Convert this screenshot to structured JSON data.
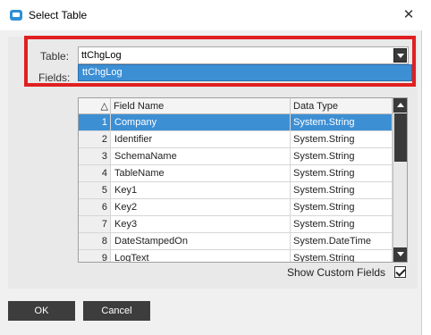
{
  "window": {
    "title": "Select Table"
  },
  "form": {
    "table_label": "Table:",
    "table_value": "ttChgLog",
    "fields_label": "Fields:",
    "dropdown_options": [
      "ttChgLog"
    ]
  },
  "grid": {
    "sort_icon": "triangle-up-icon",
    "columns": [
      "Field Name",
      "Data Type"
    ],
    "rows": [
      {
        "num": "1",
        "name": "Company",
        "type": "System.String",
        "selected": true
      },
      {
        "num": "2",
        "name": "Identifier",
        "type": "System.String"
      },
      {
        "num": "3",
        "name": "SchemaName",
        "type": "System.String"
      },
      {
        "num": "4",
        "name": "TableName",
        "type": "System.String"
      },
      {
        "num": "5",
        "name": "Key1",
        "type": "System.String"
      },
      {
        "num": "6",
        "name": "Key2",
        "type": "System.String"
      },
      {
        "num": "7",
        "name": "Key3",
        "type": "System.String"
      },
      {
        "num": "8",
        "name": "DateStampedOn",
        "type": "System.DateTime"
      },
      {
        "num": "9",
        "name": "LogText",
        "type": "System.String"
      }
    ]
  },
  "options": {
    "show_custom_fields_label": "Show Custom Fields",
    "show_custom_fields_checked": true
  },
  "buttons": {
    "ok": "OK",
    "cancel": "Cancel"
  },
  "colors": {
    "selection": "#3d8fd4",
    "highlight_border": "#e02020",
    "button_bg": "#3d3d3d"
  }
}
